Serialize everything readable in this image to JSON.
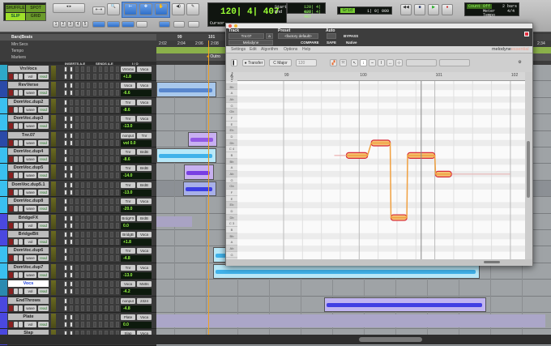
{
  "toolbar": {
    "modes": [
      "SHUFFLE",
      "SPOT",
      "SLIP",
      "GRID"
    ],
    "active_mode": "SLIP",
    "zoom_presets": [
      "1",
      "2",
      "3",
      "4",
      "5"
    ],
    "counter": "120| 4| 407",
    "counter_label": "Cursor",
    "start_label": "Start",
    "start_value": "120| 4| 407",
    "end_label": "End",
    "end_value": "120| 4| 407",
    "grid_label": "Grid",
    "grid_value": "1| 0| 000",
    "count_off": "Count Off",
    "count_off_value": "2 bars",
    "meter_label": "Meter",
    "meter_value": "4/4",
    "tempo_label": "Tempo"
  },
  "rulers": {
    "main_label": "Bars|Beats",
    "rows": [
      "Min:Secs",
      "Tempo",
      "Markers"
    ],
    "bars": [
      "99",
      "101"
    ],
    "times": [
      "2:02",
      "2:04",
      "2:06",
      "2:08"
    ],
    "marker": "Outro",
    "right_time": "2:34"
  },
  "columns": {
    "inserts": "INSERTS A-E",
    "sends": "SENDS A-E",
    "io": "I / O"
  },
  "tracks": [
    {
      "name": "VrsVocs",
      "mode": "vol",
      "auto": "read",
      "in": "VrsVox",
      "out": "Voca",
      "vol": "+1.8",
      "color": "#2ea8c8"
    },
    {
      "name": "RevVerse",
      "mode": "wave",
      "auto": "read",
      "in": "Voca",
      "out": "Voca",
      "vol": "-6.6",
      "color": "#2a4aa8"
    },
    {
      "name": "DomVoc.dup2",
      "mode": "wave",
      "auto": "read",
      "in": "Tnr",
      "out": "Voca",
      "vol": "-8.6",
      "color": "#3ac0f0"
    },
    {
      "name": "DomVoc.dup3",
      "mode": "wave",
      "auto": "read",
      "in": "Tnr",
      "out": "Voca",
      "vol": "-13.0",
      "color": "#3ac0f0"
    },
    {
      "name": "Tnr.07",
      "mode": "wave",
      "auto": "read",
      "in": "nonput",
      "out": "Tnr",
      "vol": "vol 0.0",
      "color": "#2a4aa8"
    },
    {
      "name": "DomVoc.dup4",
      "mode": "wave",
      "auto": "read",
      "in": "Tnr",
      "out": "BrdB",
      "vol": "-8.6",
      "color": "#3ac0f0"
    },
    {
      "name": "DomVoc.dup5",
      "mode": "wave",
      "auto": "read",
      "in": "Tnr",
      "out": "BrdB",
      "vol": "-14.0",
      "color": "#3ac0f0"
    },
    {
      "name": "DomVoc.dup5.1",
      "mode": "wave",
      "auto": "read",
      "in": "Tnr",
      "out": "BrdB",
      "vol": "-13.0",
      "color": "#3ac0f0"
    },
    {
      "name": "DomVoc.dup8",
      "mode": "wave",
      "auto": "read",
      "in": "Tnr",
      "out": "Voca",
      "vol": "-20.0",
      "color": "#3ac0f0"
    },
    {
      "name": "BridgeFX",
      "mode": "vol",
      "auto": "read",
      "in": "BrdgFX",
      "out": "BrdB",
      "vol": "0.0",
      "color": "#4a48e0"
    },
    {
      "name": "BridgeBit",
      "mode": "vol",
      "auto": "read",
      "in": "BridgB",
      "out": "Voca",
      "vol": "+1.8",
      "color": "#4a48e0"
    },
    {
      "name": "DomVoc.dup6",
      "mode": "wave",
      "auto": "read",
      "in": "Tnr",
      "out": "Voca",
      "vol": "-4.8",
      "color": "#3ac0f0"
    },
    {
      "name": "DomVoc.dup7",
      "mode": "wave",
      "auto": "read",
      "in": "Tnr",
      "out": "Voca",
      "vol": "-13.0",
      "color": "#3ac0f0"
    },
    {
      "name": "Vocs",
      "mode": "vol",
      "auto": "read",
      "in": "Voca",
      "out": "MxBs",
      "vol": "-4.2",
      "color": "#2a8ab0"
    },
    {
      "name": "EndThrows",
      "mode": "wave",
      "auto": "read",
      "in": "nonput",
      "out": "2324",
      "vol": "-4.8",
      "color": "#4a48e0"
    },
    {
      "name": "Plate",
      "mode": "vol",
      "auto": "read",
      "in": "Plate",
      "out": "Voca",
      "vol": "0.0",
      "color": "#4a48e0"
    },
    {
      "name": "Slap",
      "mode": "vol",
      "auto": "read",
      "in": "Slap",
      "out": "Voca",
      "vol": "",
      "color": "#4a48e0"
    }
  ],
  "melodyne": {
    "header": {
      "track": "Track",
      "track_value": "Tnr.07",
      "track_sub": "a",
      "plugin": "Melodyne",
      "preset": "Preset",
      "preset_value": "<factory default>",
      "compare": "COMPARE",
      "auto": "Auto",
      "bypass": "BYPASS",
      "safe": "SAFE",
      "native": "Native"
    },
    "menu": [
      "Settings",
      "Edit",
      "Algorithm",
      "Options",
      "Help"
    ],
    "logo": "melodyne",
    "logo_edition": "essential",
    "transfer": "Transfer",
    "scale": "C Major",
    "tempo": "120",
    "bars": [
      "99",
      "100",
      "101",
      "102"
    ],
    "pitch_labels": [
      "B",
      "Bb",
      "A",
      "Ab",
      "G",
      "Gb",
      "F",
      "E",
      "Eb",
      "D",
      "Db",
      "C 4",
      "B",
      "Bb",
      "A",
      "Ab",
      "G",
      "Gb",
      "F",
      "E",
      "Eb",
      "D",
      "Db",
      "C 3",
      "B",
      "Bb",
      "A",
      "Ab",
      "G"
    ],
    "notes": [
      {
        "pitch": "B3",
        "start": 99.83,
        "end": 100.11
      },
      {
        "pitch": "Db4",
        "start": 100.16,
        "end": 100.41
      },
      {
        "pitch": "Db3",
        "start": 100.42,
        "end": 100.63
      },
      {
        "pitch": "B3",
        "start": 100.64,
        "end": 101.0
      },
      {
        "pitch": "Ab3",
        "start": 101.01,
        "end": 101.22,
        "tail_end": 102.0
      }
    ],
    "colors": {
      "note": "#f4c070",
      "note_edge": "#d82a3a",
      "pitch_line": "#f0a040"
    }
  }
}
